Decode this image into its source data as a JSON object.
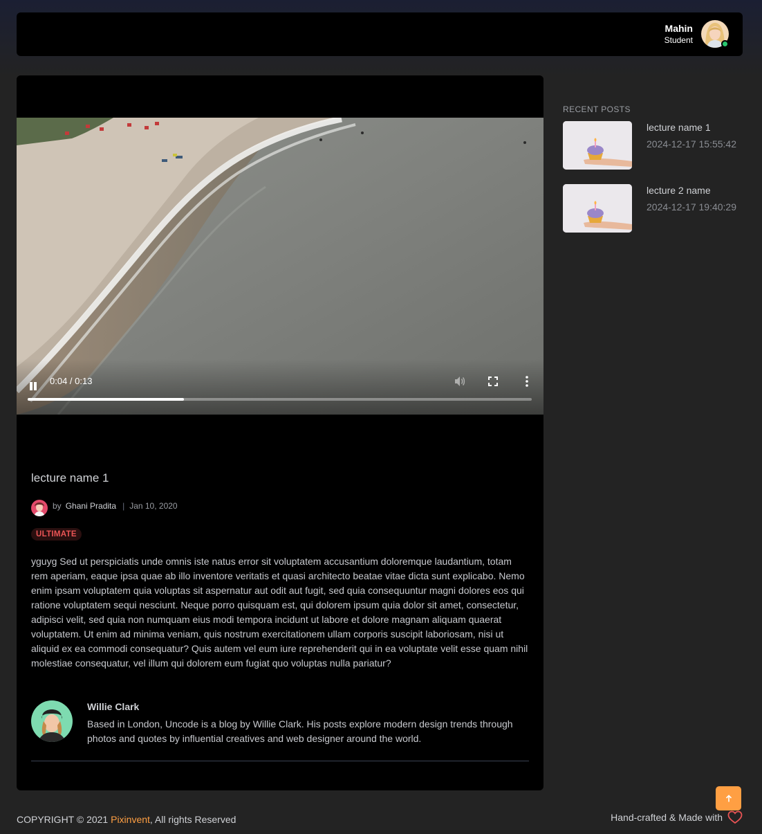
{
  "navbar": {
    "user_name": "Mahin",
    "user_role": "Student",
    "status_color": "#28c76f"
  },
  "video": {
    "time_display": "0:04 / 0:13",
    "progress_fraction": 0.31,
    "controls": [
      "pause-icon",
      "volume-icon",
      "fullscreen-icon",
      "more-vertical-icon"
    ]
  },
  "post": {
    "title": "lecture name 1",
    "by_label": "by",
    "author": "Ghani Pradita",
    "separator": "|",
    "date": "Jan 10, 2020",
    "badge": "ULTIMATE",
    "body": "yguyg Sed ut perspiciatis unde omnis iste natus error sit voluptatem accusantium doloremque laudantium, totam rem aperiam, eaque ipsa quae ab illo inventore veritatis et quasi architecto beatae vitae dicta sunt explicabo. Nemo enim ipsam voluptatem quia voluptas sit aspernatur aut odit aut fugit, sed quia consequuntur magni dolores eos qui ratione voluptatem sequi nesciunt. Neque porro quisquam est, qui dolorem ipsum quia dolor sit amet, consectetur, adipisci velit, sed quia non numquam eius modi tempora incidunt ut labore et dolore magnam aliquam quaerat voluptatem. Ut enim ad minima veniam, quis nostrum exercitationem ullam corporis suscipit laboriosam, nisi ut aliquid ex ea commodi consequatur? Quis autem vel eum iure reprehenderit qui in ea voluptate velit esse quam nihil molestiae consequatur, vel illum qui dolorem eum fugiat quo voluptas nulla pariatur?"
  },
  "bio": {
    "name": "Willie Clark",
    "text": "Based in London, Uncode is a blog by Willie Clark. His posts explore modern design trends through photos and quotes by influential creatives and web designer around the world."
  },
  "sidebar": {
    "title": "RECENT POSTS",
    "posts": [
      {
        "name": "lecture name 1",
        "date": "2024-12-17 15:55:42"
      },
      {
        "name": "lecture 2 name",
        "date": "2024-12-17 19:40:29"
      }
    ]
  },
  "footer": {
    "copyright_prefix": "COPYRIGHT © 2021 ",
    "brand": "Pixinvent",
    "copyright_suffix": ", All rights Reserved",
    "made_with": "Hand-crafted & Made with",
    "accent_color": "#ff9f43"
  }
}
